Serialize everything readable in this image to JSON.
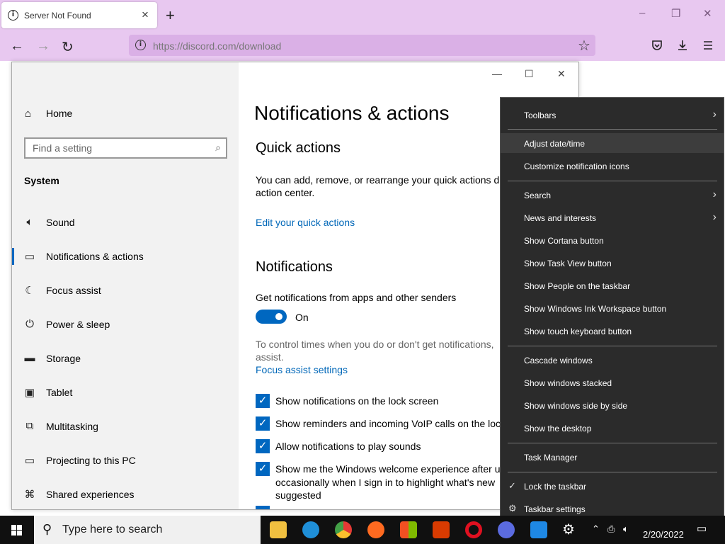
{
  "browser": {
    "tab_title": "Server Not Found",
    "tab_info_glyph": "i",
    "new_tab_glyph": "+",
    "url": "https://discord.com/download",
    "url_info_glyph": "i",
    "controls": {
      "minimize": "–",
      "restore": "❐",
      "close": "✕"
    },
    "icons": [
      "back-icon",
      "forward-icon",
      "reload-icon",
      "star-icon",
      "pocket-icon",
      "downloads-icon",
      "menu-icon"
    ]
  },
  "settings": {
    "window_controls": {
      "minimize": "—",
      "maximize": "☐",
      "close": "✕"
    },
    "home_label": "Home",
    "search_placeholder": "Find a setting",
    "section_label": "System",
    "nav_items": [
      {
        "label": "Sound",
        "icon": "speaker-icon"
      },
      {
        "label": "Notifications & actions",
        "icon": "notification-icon"
      },
      {
        "label": "Focus assist",
        "icon": "moon-icon"
      },
      {
        "label": "Power & sleep",
        "icon": "power-icon"
      },
      {
        "label": "Storage",
        "icon": "storage-icon"
      },
      {
        "label": "Tablet",
        "icon": "tablet-icon"
      },
      {
        "label": "Multitasking",
        "icon": "multitasking-icon"
      },
      {
        "label": "Projecting to this PC",
        "icon": "projecting-icon"
      },
      {
        "label": "Shared experiences",
        "icon": "shared-icon"
      }
    ],
    "selected_nav": "Notifications & actions",
    "page_title": "Notifications & actions",
    "quick_actions_heading": "Quick actions",
    "quick_actions_text_1": "You can add, remove, or rearrange your quick actions di",
    "quick_actions_text_2": "action center.",
    "edit_quick_actions_link": "Edit your quick actions",
    "notifications_heading": "Notifications",
    "get_notifications_label": "Get notifications from apps and other senders",
    "toggle_state": "On",
    "control_times_text_1": "To control times when you do or don't get notifications,",
    "control_times_text_2": "assist.",
    "focus_assist_link": "Focus assist settings",
    "checkboxes": [
      {
        "line1": "Show notifications on the lock screen",
        "checked": true
      },
      {
        "line1": "Show reminders and incoming VoIP calls on the loc",
        "checked": true
      },
      {
        "line1": "Allow notifications to play sounds",
        "checked": true
      },
      {
        "line1": "Show me the Windows welcome experience after u",
        "line2": "occasionally when I sign in to highlight what's new",
        "line3": "suggested",
        "checked": true
      }
    ]
  },
  "context_menu": {
    "items": [
      {
        "label": "Toolbars",
        "submenu": true
      },
      {
        "label": "Adjust date/time",
        "highlighted": true
      },
      {
        "label": "Customize notification icons"
      },
      {
        "label": "Search",
        "submenu": true
      },
      {
        "label": "News and interests",
        "submenu": true
      },
      {
        "label": "Show Cortana button"
      },
      {
        "label": "Show Task View button"
      },
      {
        "label": "Show People on the taskbar"
      },
      {
        "label": "Show Windows Ink Workspace button"
      },
      {
        "label": "Show touch keyboard button"
      },
      {
        "label": "Cascade windows"
      },
      {
        "label": "Show windows stacked"
      },
      {
        "label": "Show windows side by side"
      },
      {
        "label": "Show the desktop"
      },
      {
        "label": "Task Manager"
      },
      {
        "label": "Lock the taskbar",
        "checked": true
      },
      {
        "label": "Taskbar settings",
        "icon": "gear-icon"
      }
    ]
  },
  "taskbar": {
    "search_placeholder": "Type here to search",
    "date": "2/20/2022",
    "apps": [
      "file-explorer-icon",
      "edge-icon",
      "chrome-icon",
      "firefox-icon",
      "store-icon",
      "office-icon",
      "opera-icon",
      "teams-icon",
      "mail-icon",
      "settings-icon"
    ],
    "colors": {
      "file-explorer": "#f0c040",
      "edge": "#1f8fd8",
      "chrome": "#4caf50",
      "firefox": "#ff6a20",
      "store": "#f5f5f5",
      "office": "#d83b01",
      "opera": "#e01020",
      "teams": "#5b6be0",
      "mail": "#1e88e5",
      "settings": "#ffffff"
    }
  }
}
